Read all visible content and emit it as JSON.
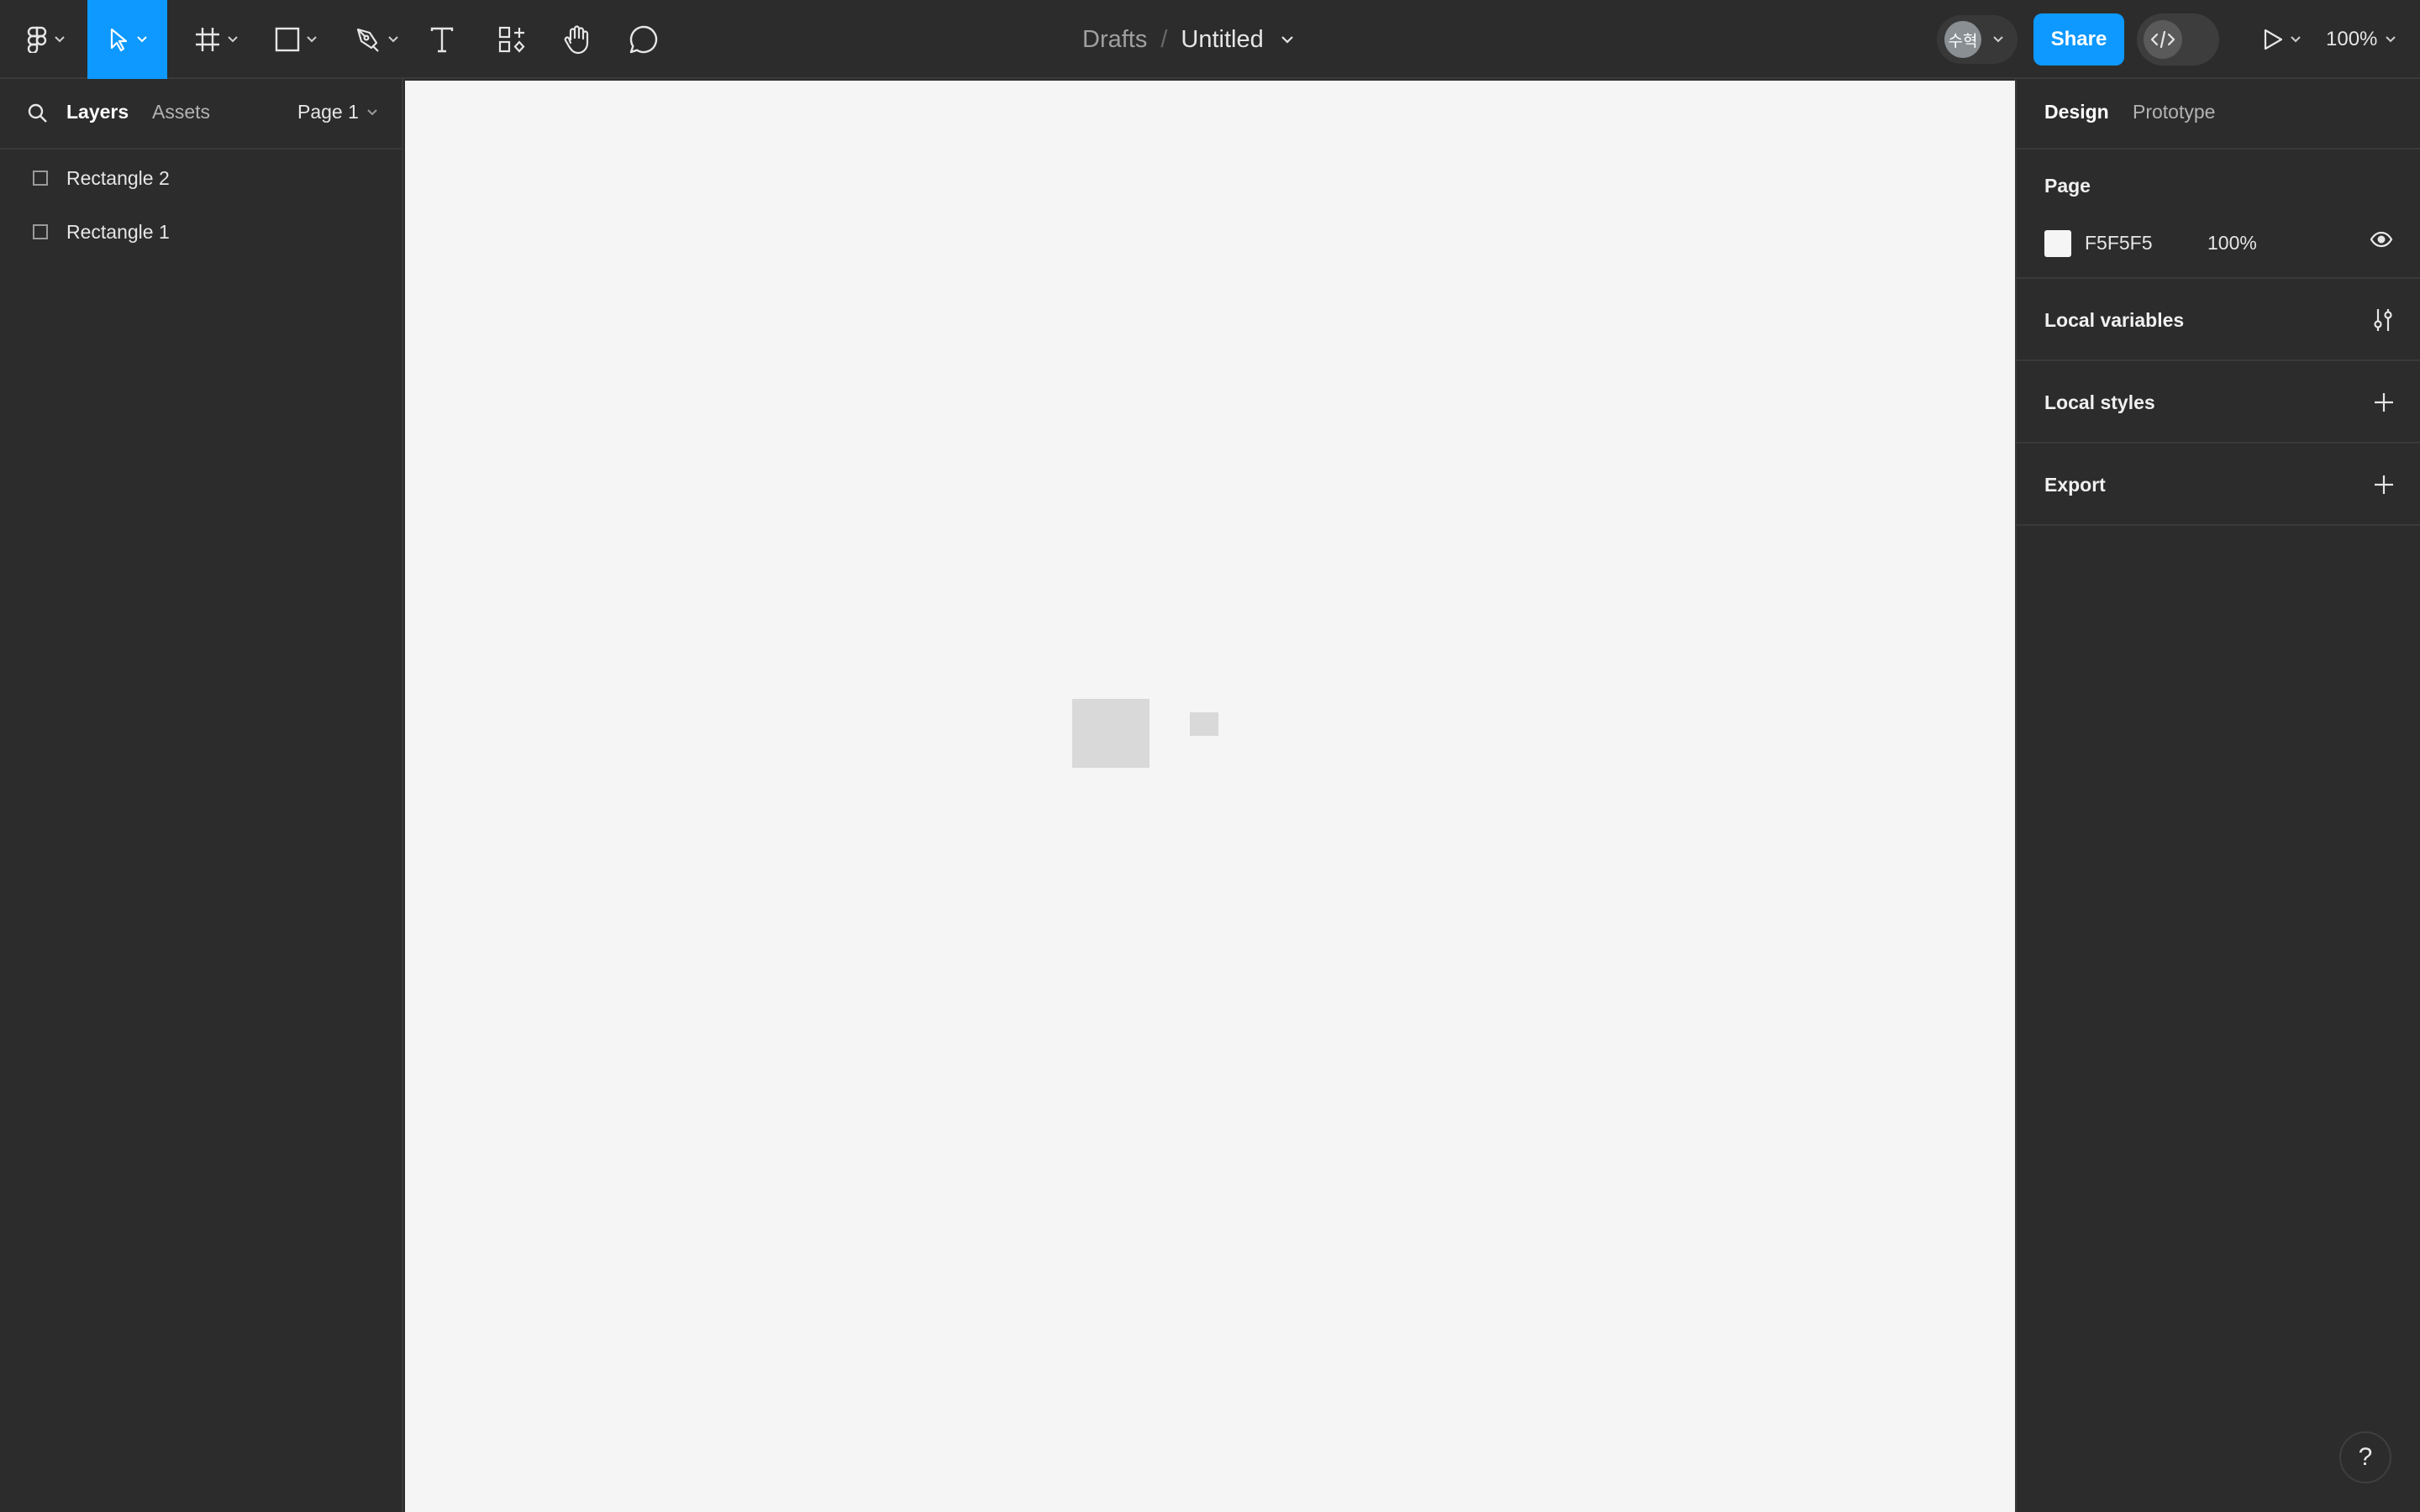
{
  "toolbar": {
    "breadcrumb_root": "Drafts",
    "breadcrumb_sep": "/",
    "file_title": "Untitled",
    "avatar_initials": "수혁",
    "share_label": "Share",
    "zoom_level": "100%",
    "active_tool": "move",
    "accent_color": "#0d99ff"
  },
  "left_panel": {
    "tabs": [
      {
        "label": "Layers",
        "active": true
      },
      {
        "label": "Assets",
        "active": false
      }
    ],
    "page_selector": "Page 1",
    "layers": [
      {
        "label": "Rectangle 2",
        "icon": "rectangle-icon"
      },
      {
        "label": "Rectangle 1",
        "icon": "rectangle-icon"
      }
    ]
  },
  "canvas": {
    "background": "#F5F5F5"
  },
  "right_panel": {
    "tabs": [
      {
        "label": "Design",
        "active": true
      },
      {
        "label": "Prototype",
        "active": false
      }
    ],
    "page_section": {
      "title": "Page",
      "fill_hex": "F5F5F5",
      "fill_opacity": "100%"
    },
    "local_variables": "Local variables",
    "local_styles": "Local styles",
    "export": "Export"
  },
  "help_label": "?"
}
